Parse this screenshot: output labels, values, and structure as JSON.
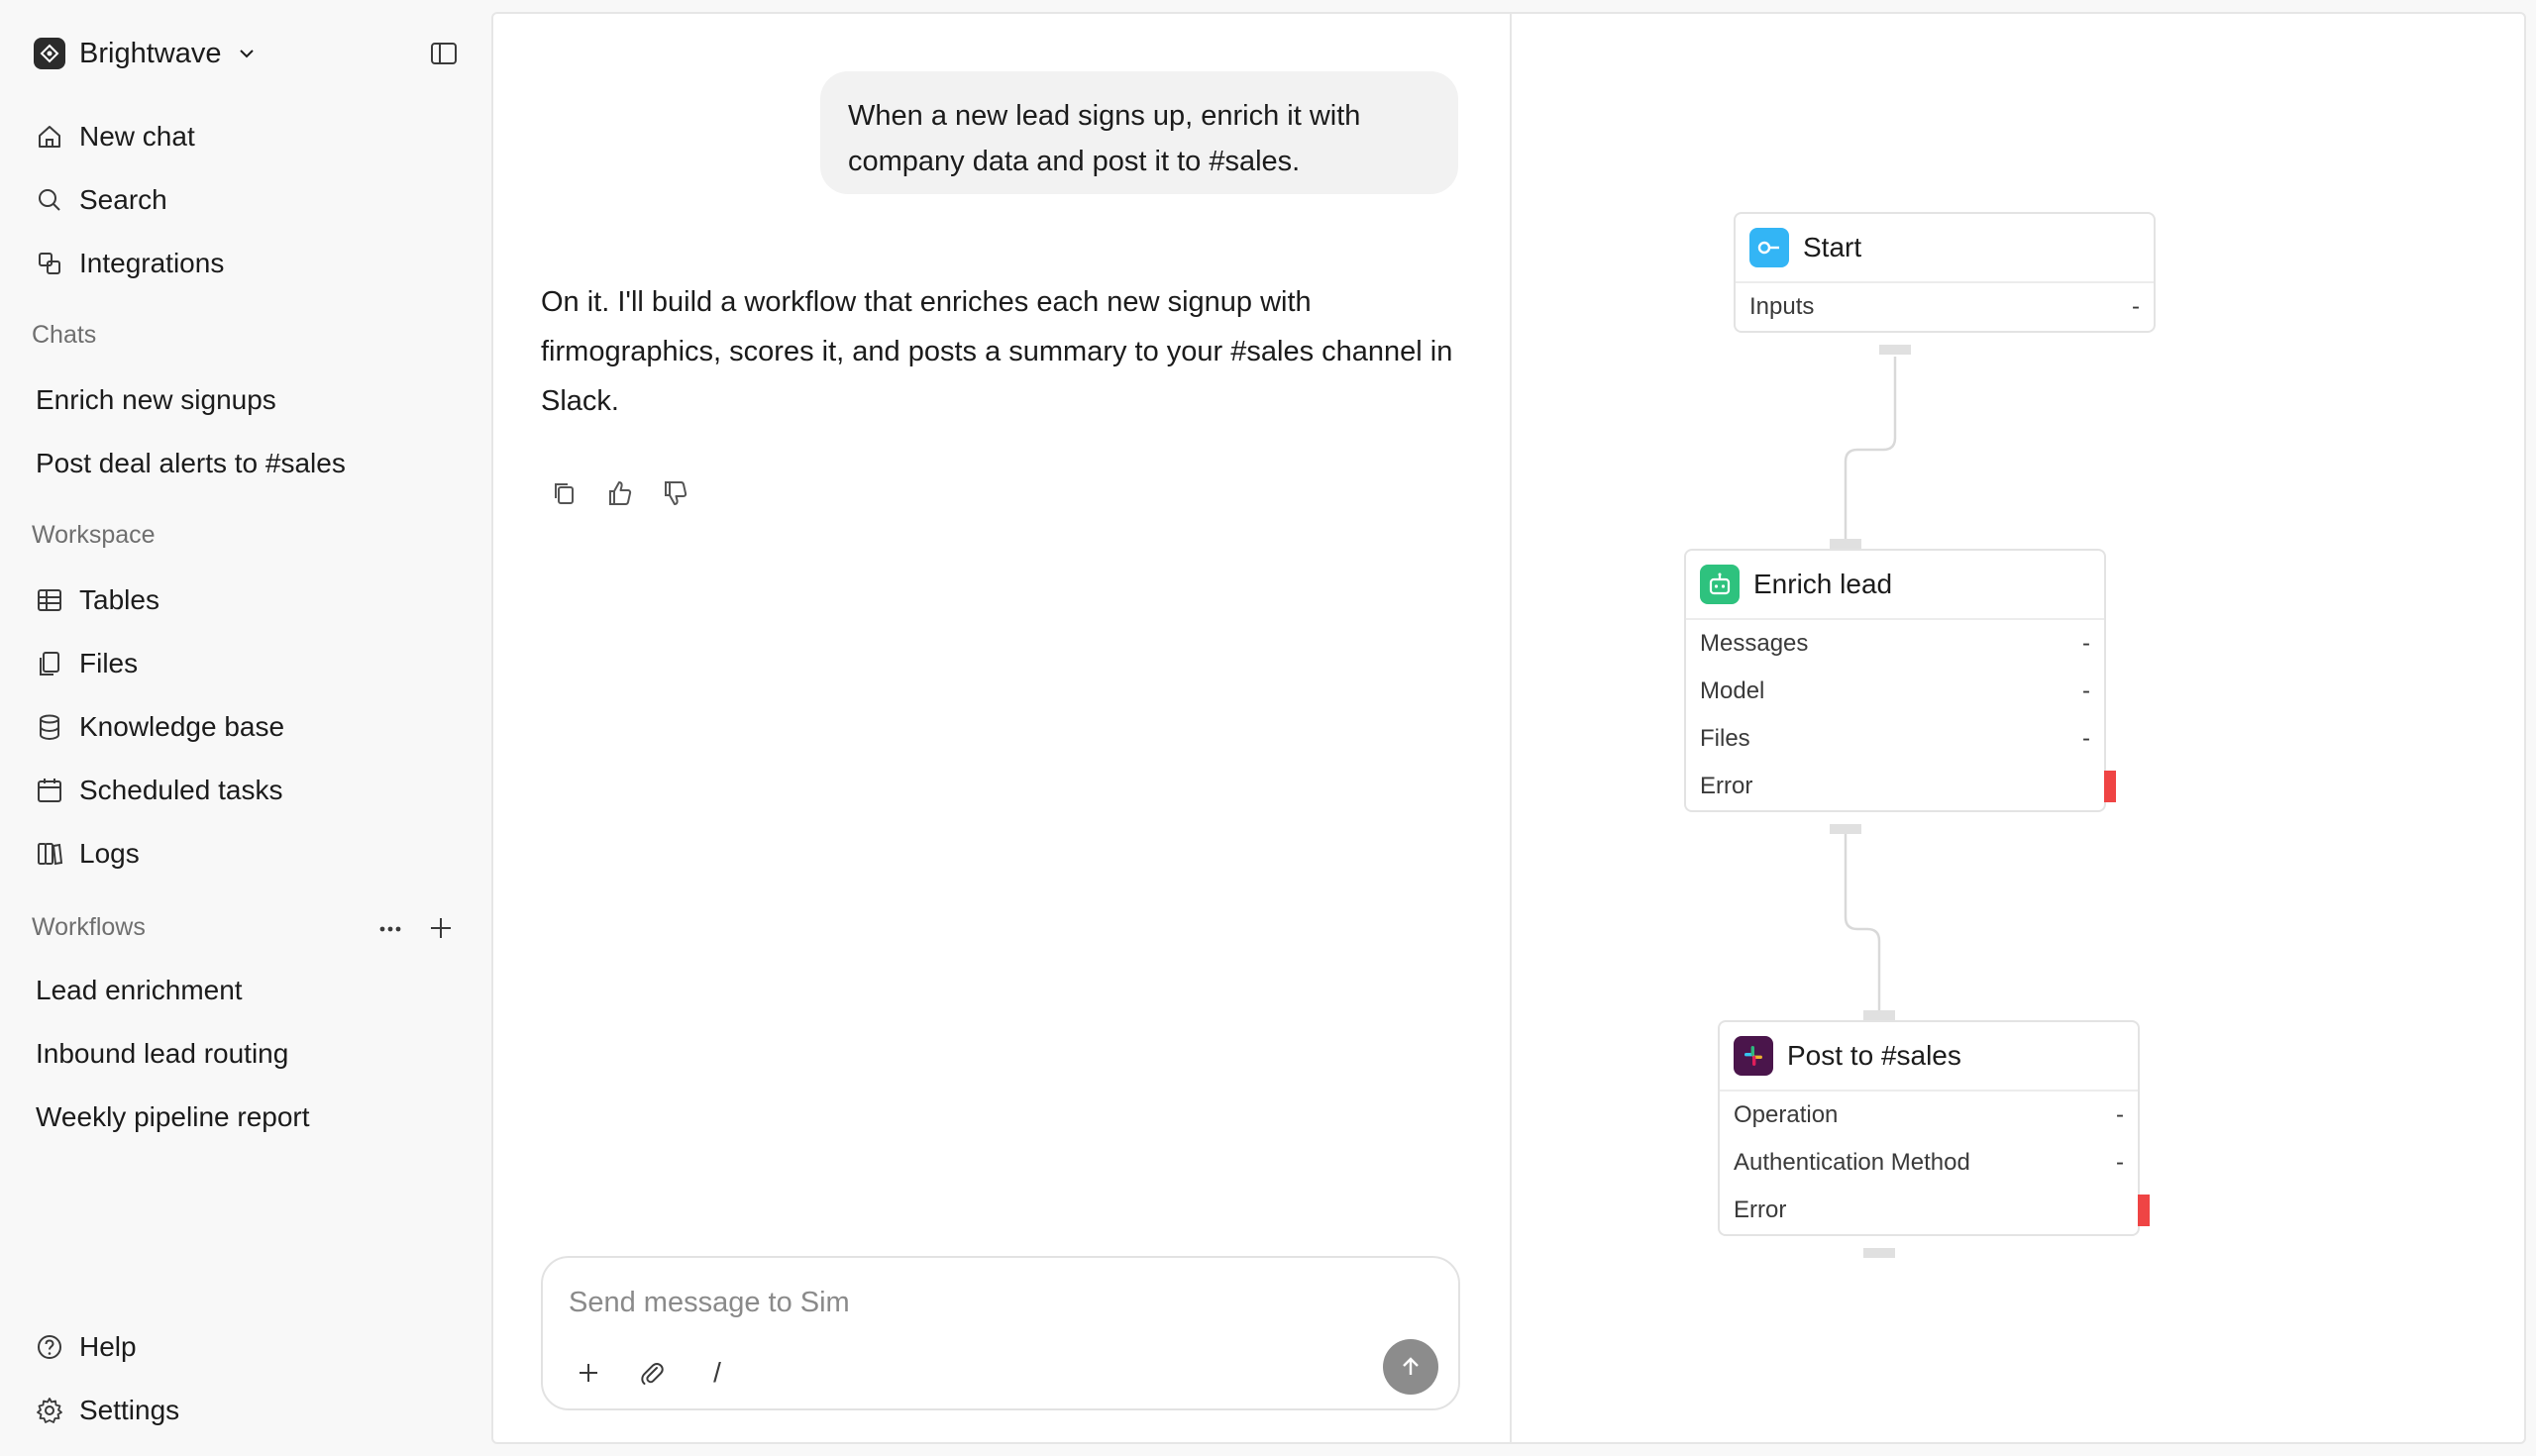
{
  "sidebar": {
    "workspace_name": "Brightwave",
    "nav": [
      {
        "label": "New chat",
        "icon": "home-icon"
      },
      {
        "label": "Search",
        "icon": "search-icon"
      },
      {
        "label": "Integrations",
        "icon": "integrations-icon"
      }
    ],
    "chats_label": "Chats",
    "chats": [
      "Enrich new signups",
      "Post deal alerts to #sales"
    ],
    "workspace_label": "Workspace",
    "workspace_items": [
      {
        "label": "Tables",
        "icon": "table-icon"
      },
      {
        "label": "Files",
        "icon": "files-icon"
      },
      {
        "label": "Knowledge base",
        "icon": "database-icon"
      },
      {
        "label": "Scheduled tasks",
        "icon": "calendar-icon"
      },
      {
        "label": "Logs",
        "icon": "logs-icon"
      }
    ],
    "workflows_label": "Workflows",
    "workflows": [
      "Lead enrichment",
      "Inbound lead routing",
      "Weekly pipeline report"
    ],
    "footer": [
      {
        "label": "Help",
        "icon": "help-icon"
      },
      {
        "label": "Settings",
        "icon": "gear-icon"
      }
    ]
  },
  "chat": {
    "user_message": "When a new lead signs up, enrich it with company data and post it to #sales.",
    "assistant_message": "On it. I'll build a workflow that enriches each new signup with firmographics, scores it, and posts a summary to your #sales channel in Slack.",
    "composer_placeholder": "Send message to Sim",
    "composer_slash": "/"
  },
  "workflow": {
    "nodes": [
      {
        "title": "Start",
        "icon": "start-icon",
        "color": "#33b5f5",
        "rows": [
          {
            "label": "Inputs",
            "value": "-"
          }
        ]
      },
      {
        "title": "Enrich lead",
        "icon": "agent-icon",
        "color": "#2ec27e",
        "rows": [
          {
            "label": "Messages",
            "value": "-"
          },
          {
            "label": "Model",
            "value": "-"
          },
          {
            "label": "Files",
            "value": "-"
          },
          {
            "label": "Error",
            "value": ""
          }
        ]
      },
      {
        "title": "Post to #sales",
        "icon": "slack-icon",
        "color": "#4a154b",
        "rows": [
          {
            "label": "Operation",
            "value": "-"
          },
          {
            "label": "Authentication Method",
            "value": "-"
          },
          {
            "label": "Error",
            "value": ""
          }
        ]
      }
    ],
    "error_color": "#ef4444"
  }
}
